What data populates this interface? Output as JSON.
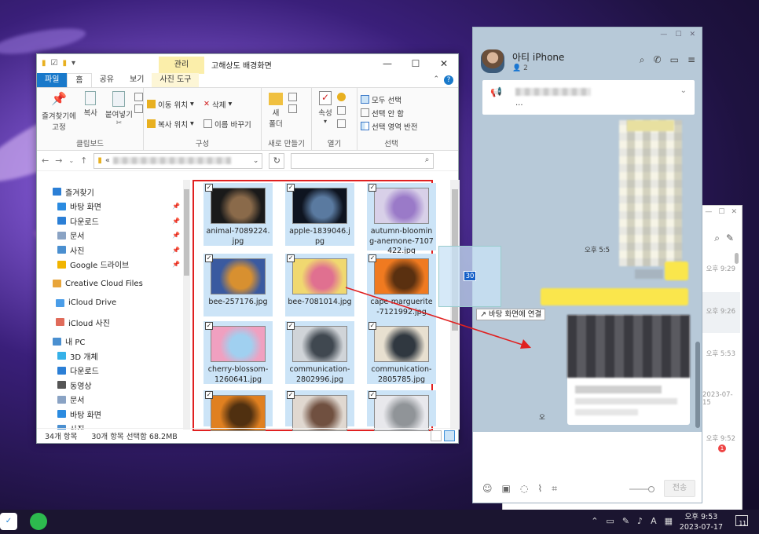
{
  "explorer": {
    "title": "고해상도 배경화면",
    "context_tab": "관리",
    "tabs": [
      "파일",
      "홈",
      "공유",
      "보기",
      "사진 도구"
    ],
    "ribbon": {
      "pin_label": "즐겨찾기에 고정",
      "copy_label": "복사",
      "paste_label": "붙여넣기",
      "move_to": "이동 위치",
      "copy_to": "복사 위치",
      "delete": "삭제",
      "rename": "이름 바꾸기",
      "new_folder": "새 폴더",
      "properties": "속성",
      "select_all": "모두 선택",
      "select_none": "선택 안 함",
      "invert_selection": "선택 영역 반전",
      "groups": [
        "클립보드",
        "구성",
        "새로 만들기",
        "열기",
        "선택"
      ]
    },
    "address_prefix": "«",
    "nav_items": [
      {
        "label": "즐겨찾기",
        "icon": "star-icon",
        "color": "#2b7fd6",
        "pinned": false
      },
      {
        "label": "바탕 화면",
        "icon": "desktop-icon",
        "color": "#2b8be0",
        "pinned": true
      },
      {
        "label": "다운로드",
        "icon": "download-icon",
        "color": "#2b7fd6",
        "pinned": true
      },
      {
        "label": "문서",
        "icon": "document-icon",
        "color": "#8aa3c4",
        "pinned": true
      },
      {
        "label": "사진",
        "icon": "pictures-icon",
        "color": "#4a8fd0",
        "pinned": true
      },
      {
        "label": "Google 드라이브",
        "icon": "google-drive-icon",
        "color": "#f1b400",
        "pinned": true
      },
      {
        "label": "Creative Cloud Files",
        "icon": "creative-cloud-icon",
        "color": "#e8a53a",
        "pinned": false
      },
      {
        "label": "iCloud Drive",
        "icon": "icloud-icon",
        "color": "#4a9de8",
        "pinned": false
      },
      {
        "label": "iCloud 사진",
        "icon": "icloud-photos-icon",
        "color": "#e06b5a",
        "pinned": false
      },
      {
        "label": "내 PC",
        "icon": "pc-icon",
        "color": "#4a8fd0",
        "pinned": false
      },
      {
        "label": "3D 개체",
        "icon": "3d-objects-icon",
        "color": "#36b1e8",
        "pinned": false
      },
      {
        "label": "다운로드",
        "icon": "download-icon",
        "color": "#2b7fd6",
        "pinned": false
      },
      {
        "label": "동영상",
        "icon": "video-icon",
        "color": "#555",
        "pinned": false
      },
      {
        "label": "문서",
        "icon": "document-icon",
        "color": "#8aa3c4",
        "pinned": false
      },
      {
        "label": "바탕 화면",
        "icon": "desktop-icon",
        "color": "#2b8be0",
        "pinned": false
      },
      {
        "label": "사진",
        "icon": "pictures-icon",
        "color": "#4a8fd0",
        "pinned": false
      }
    ],
    "files": [
      {
        "name": "animal-7089224.jpg",
        "colors": [
          "#1a1a1a",
          "#8a6a4a"
        ]
      },
      {
        "name": "apple-1839046.jpg",
        "colors": [
          "#0e1420",
          "#5a7aa0"
        ]
      },
      {
        "name": "autumn-blooming-anemone-7107422.jpg",
        "colors": [
          "#d8d0e8",
          "#9a7ac8"
        ]
      },
      {
        "name": "bee-257176.jpg",
        "colors": [
          "#3a5aa0",
          "#d89030"
        ]
      },
      {
        "name": "bee-7081014.jpg",
        "colors": [
          "#f0d870",
          "#e07090"
        ]
      },
      {
        "name": "cape-marguerite-7121992.jpg",
        "colors": [
          "#f07a20",
          "#5a3010"
        ]
      },
      {
        "name": "cherry-blossom-1260641.jpg",
        "colors": [
          "#f0a0c0",
          "#a0d0f0"
        ]
      },
      {
        "name": "communication-2802996.jpg",
        "colors": [
          "#d0d4d8",
          "#404850"
        ]
      },
      {
        "name": "communication-2805785.jpg",
        "colors": [
          "#e8e0d0",
          "#303840"
        ]
      },
      {
        "name": "",
        "colors": [
          "#e08020",
          "#503010"
        ]
      },
      {
        "name": "",
        "colors": [
          "#e0d8d0",
          "#705040"
        ]
      },
      {
        "name": "",
        "colors": [
          "#e8e8ec",
          "#909498"
        ]
      }
    ],
    "status_count": "34개 항목",
    "status_selected": "30개 항목 선택함 68.2MB"
  },
  "drag": {
    "count": "30",
    "tooltip": "바탕 화면에 연결"
  },
  "chat": {
    "room_name": "아티 iPhone",
    "member_count": "2",
    "notice_text": "...",
    "time_1": "오후 5:5",
    "time_2": "오",
    "send_label": "전송"
  },
  "chat_back": {
    "times": [
      "오후 9:29",
      "오후 9:26",
      "오후 5:53",
      "2023-07-15",
      "오후 9:52"
    ],
    "badge": "1"
  },
  "taskbar": {
    "time": "오후 9:53",
    "date": "2023-07-17",
    "notifications": "11",
    "ime": "A"
  }
}
